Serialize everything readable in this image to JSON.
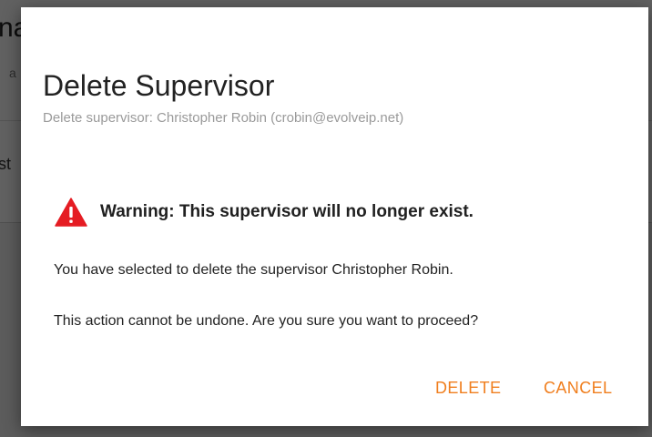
{
  "background_page": {
    "title_fragment": "na",
    "subtitle_fragment": "a",
    "item_fragment": "st"
  },
  "dialog": {
    "title": "Delete Supervisor",
    "subtitle": "Delete supervisor: Christopher Robin (crobin@evolveip.net)",
    "warning_icon": "warning-triangle-icon",
    "warning_color": "#e51c23",
    "warning_text": "Warning: This supervisor will no longer exist.",
    "body_line_1": "You have selected to delete the supervisor Christopher Robin.",
    "body_line_2": "This action cannot be undone. Are you sure you want to proceed?",
    "buttons": {
      "delete_label": "DELETE",
      "cancel_label": "CANCEL"
    },
    "accent_color": "#f07e1d"
  }
}
